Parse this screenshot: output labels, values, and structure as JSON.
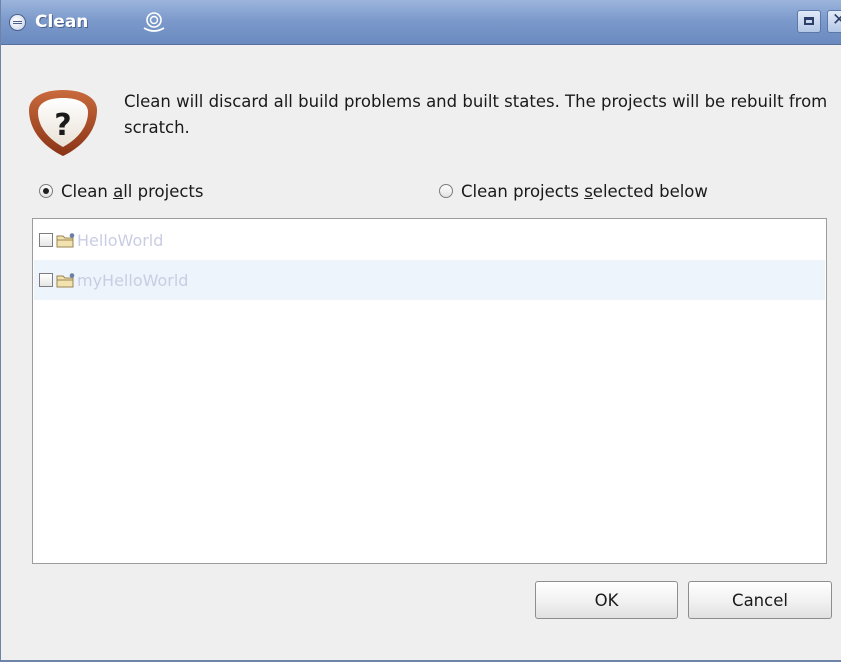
{
  "window": {
    "title": "Clean",
    "title_icons": [
      "eclipse-icon",
      "swirl-icon"
    ],
    "window_buttons": [
      "maximize-icon",
      "close-icon"
    ]
  },
  "message": {
    "icon": "question-icon",
    "text": "Clean will discard all build problems and built states.  The projects will be rebuilt from scratch."
  },
  "options": {
    "clean_all": {
      "prefix": "Clean ",
      "mnemonic": "a",
      "suffix": "ll projects",
      "selected": true
    },
    "clean_selected": {
      "prefix": "Clean projects ",
      "mnemonic": "s",
      "suffix": "elected below",
      "selected": false
    }
  },
  "projects": [
    {
      "name": "HelloWorld",
      "checked": false,
      "icon": "project-folder-icon"
    },
    {
      "name": "myHelloWorld",
      "checked": false,
      "icon": "project-folder-icon"
    }
  ],
  "buttons": {
    "ok": "OK",
    "cancel": "Cancel"
  },
  "colors": {
    "titlebar": "#7c9acb",
    "disabled_text": "#c9cde3",
    "alt_row": "#eef4fb"
  }
}
